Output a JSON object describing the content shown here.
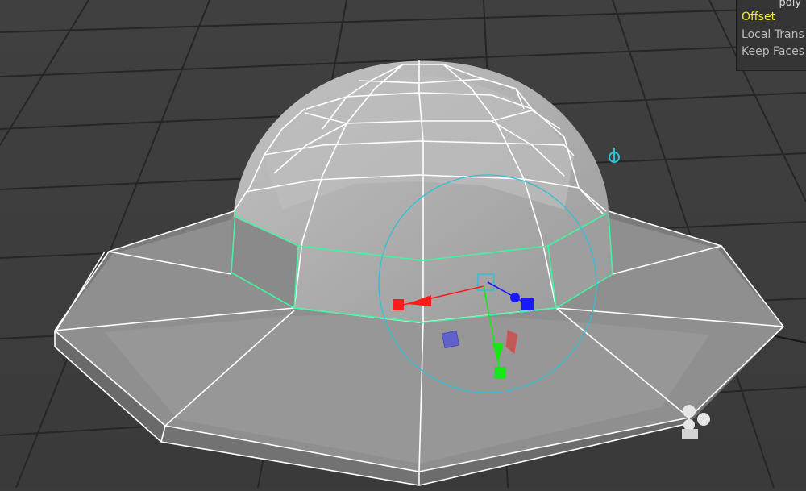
{
  "viewport": {
    "background": "#3b3b3b",
    "mesh_color": "#cfcfcf",
    "wire_color": "#ffffff",
    "selection_color": "#3ff5a0"
  },
  "hud": {
    "title": "poly",
    "items": [
      {
        "label": "Offset",
        "active": true
      },
      {
        "label": "Local Trans",
        "active": false
      },
      {
        "label": "Keep Faces",
        "active": false
      }
    ]
  },
  "manipulator": {
    "x_axis_color": "#ff1a1a",
    "y_axis_color": "#19e619",
    "z_axis_color": "#1919ff",
    "rotate_ring_color": "#2fc0d8"
  },
  "icons": [
    "pivot-icon",
    "camera-icon"
  ]
}
